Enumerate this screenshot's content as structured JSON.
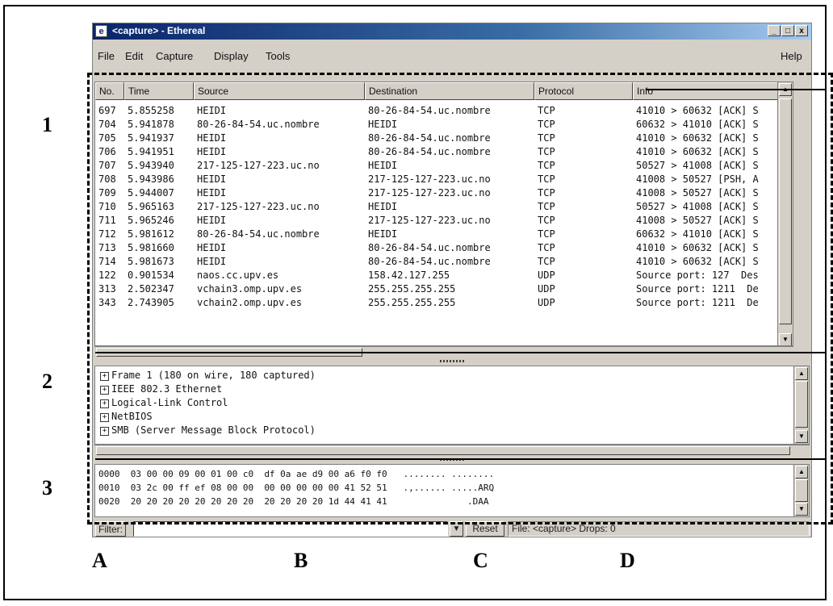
{
  "window": {
    "title": "<capture> - Ethereal",
    "icon": "ethereal-app-icon",
    "buttons": [
      "_",
      "□",
      "x"
    ]
  },
  "menu": {
    "items": [
      {
        "label": "File",
        "underline": "F"
      },
      {
        "label": "Edit",
        "underline": "E"
      },
      {
        "label": "Capture",
        "underline": "C"
      },
      {
        "label": "Display",
        "underline": "D"
      },
      {
        "label": "Tools",
        "underline": "T"
      }
    ],
    "help": "Help"
  },
  "packet_list": {
    "columns": [
      "No.",
      "Time",
      "Source",
      "Destination",
      "Protocol",
      "Info"
    ],
    "rows": [
      [
        "697",
        "5.855258",
        "HEIDI",
        "80-26-84-54.uc.nombre",
        "TCP",
        "41010 > 60632 [ACK] S"
      ],
      [
        "704",
        "5.941878",
        "80-26-84-54.uc.nombre",
        "HEIDI",
        "TCP",
        "60632 > 41010 [ACK] S"
      ],
      [
        "705",
        "5.941937",
        "HEIDI",
        "80-26-84-54.uc.nombre",
        "TCP",
        "41010 > 60632 [ACK] S"
      ],
      [
        "706",
        "5.941951",
        "HEIDI",
        "80-26-84-54.uc.nombre",
        "TCP",
        "41010 > 60632 [ACK] S"
      ],
      [
        "707",
        "5.943940",
        "217-125-127-223.uc.no",
        "HEIDI",
        "TCP",
        "50527 > 41008 [ACK] S"
      ],
      [
        "708",
        "5.943986",
        "HEIDI",
        "217-125-127-223.uc.no",
        "TCP",
        "41008 > 50527 [PSH, A"
      ],
      [
        "709",
        "5.944007",
        "HEIDI",
        "217-125-127-223.uc.no",
        "TCP",
        "41008 > 50527 [ACK] S"
      ],
      [
        "710",
        "5.965163",
        "217-125-127-223.uc.no",
        "HEIDI",
        "TCP",
        "50527 > 41008 [ACK] S"
      ],
      [
        "711",
        "5.965246",
        "HEIDI",
        "217-125-127-223.uc.no",
        "TCP",
        "41008 > 50527 [ACK] S"
      ],
      [
        "712",
        "5.981612",
        "80-26-84-54.uc.nombre",
        "HEIDI",
        "TCP",
        "60632 > 41010 [ACK] S"
      ],
      [
        "713",
        "5.981660",
        "HEIDI",
        "80-26-84-54.uc.nombre",
        "TCP",
        "41010 > 60632 [ACK] S"
      ],
      [
        "714",
        "5.981673",
        "HEIDI",
        "80-26-84-54.uc.nombre",
        "TCP",
        "41010 > 60632 [ACK] S"
      ],
      [
        "122",
        "0.901534",
        "naos.cc.upv.es",
        "158.42.127.255",
        "UDP",
        "Source port: 127  Des"
      ],
      [
        "313",
        "2.502347",
        "vchain3.omp.upv.es",
        "255.255.255.255",
        "UDP",
        "Source port: 1211  De"
      ],
      [
        "343",
        "2.743905",
        "vchain2.omp.upv.es",
        "255.255.255.255",
        "UDP",
        "Source port: 1211  De"
      ]
    ]
  },
  "detail_tree": [
    "Frame 1 (180 on wire, 180 captured)",
    "IEEE 802.3 Ethernet",
    "Logical-Link Control",
    "NetBIOS",
    "SMB (Server Message Block Protocol)"
  ],
  "hex_dump": [
    {
      "offset": "0000",
      "hex": "03 00 00 09 00 01 00 c0  df 0a ae d9 00 a6 f0 f0",
      "ascii": "........ ........"
    },
    {
      "offset": "0010",
      "hex": "03 2c 00 ff ef 08 00 00  00 00 00 00 00 41 52 51",
      "ascii": ".,...... .....ARQ"
    },
    {
      "offset": "0020",
      "hex": "20 20 20 20 20 20 20 20  20 20 20 20 1d 44 41 41",
      "ascii": "            .DAA"
    }
  ],
  "statusbar": {
    "filter_label": "Filter:",
    "filter_value": "",
    "reset_label": "Reset",
    "status": "File: <capture>  Drops: 0"
  },
  "annotations": {
    "numbers": [
      "1",
      "2",
      "3"
    ],
    "letters": [
      "A",
      "B",
      "C",
      "D"
    ]
  }
}
